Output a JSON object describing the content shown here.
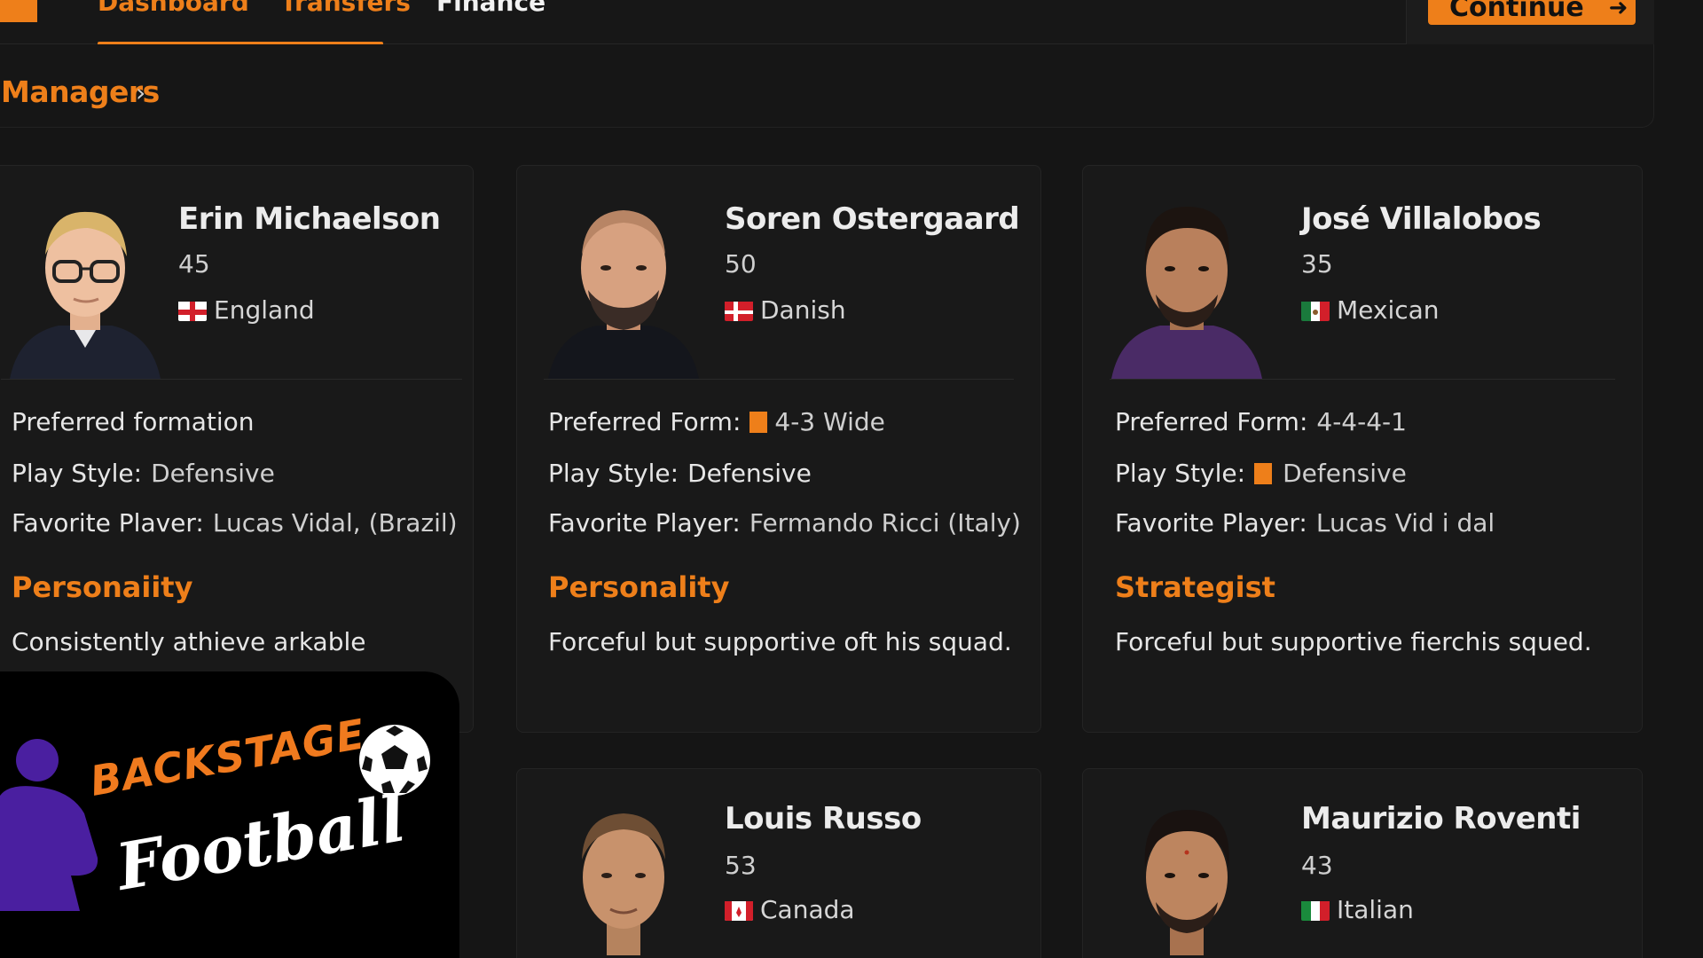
{
  "nav": {
    "tabs": [
      "Dashboard",
      "Transfers",
      "Finance"
    ],
    "continue_label": "Continue"
  },
  "breadcrumb": {
    "label": "Managers"
  },
  "labels": {
    "preferred_formation_full": "Preferred formation",
    "preferred_form": "Preferred Form:",
    "play_style": "Play Style:",
    "favorite_player": "Favorite Player:",
    "favorite_player_typo": "Favorite Plaver:"
  },
  "managers": [
    {
      "name": "Erin Michaelson",
      "age": "45",
      "nationality": "England",
      "formation": "",
      "play_style": "Defensive",
      "favorite_player": "Lucas Vidal, (Brazil)",
      "section_title": "Personaiity",
      "description": "Consistently athieve  arkable"
    },
    {
      "name": "Soren Ostergaard",
      "age": "50",
      "nationality": "Danish",
      "formation": "4-3 Wide",
      "play_style": "Defensive",
      "favorite_player": "Fermando Ricci  (Italy)",
      "section_title": "Personality",
      "description": "Forceful but supportive oft his squad."
    },
    {
      "name": "José Villalobos",
      "age": "35",
      "nationality": "Mexican",
      "formation": "4-4-4-1",
      "play_style": "Defensive",
      "favorite_player": "Lucas Vid i dal",
      "section_title": "Strategist",
      "description": "Forceful but supportive fierchis  squed."
    },
    {
      "name": "Louis Russo",
      "age": "53",
      "nationality": "Canada"
    },
    {
      "name": "Maurizio Roventi",
      "age": "43",
      "nationality": "Italian"
    }
  ],
  "watermark": {
    "line1": "BACKSTAGE",
    "line2": "Football"
  },
  "colors": {
    "accent": "#ee7f1a",
    "background": "#151515",
    "card": "#191919"
  }
}
